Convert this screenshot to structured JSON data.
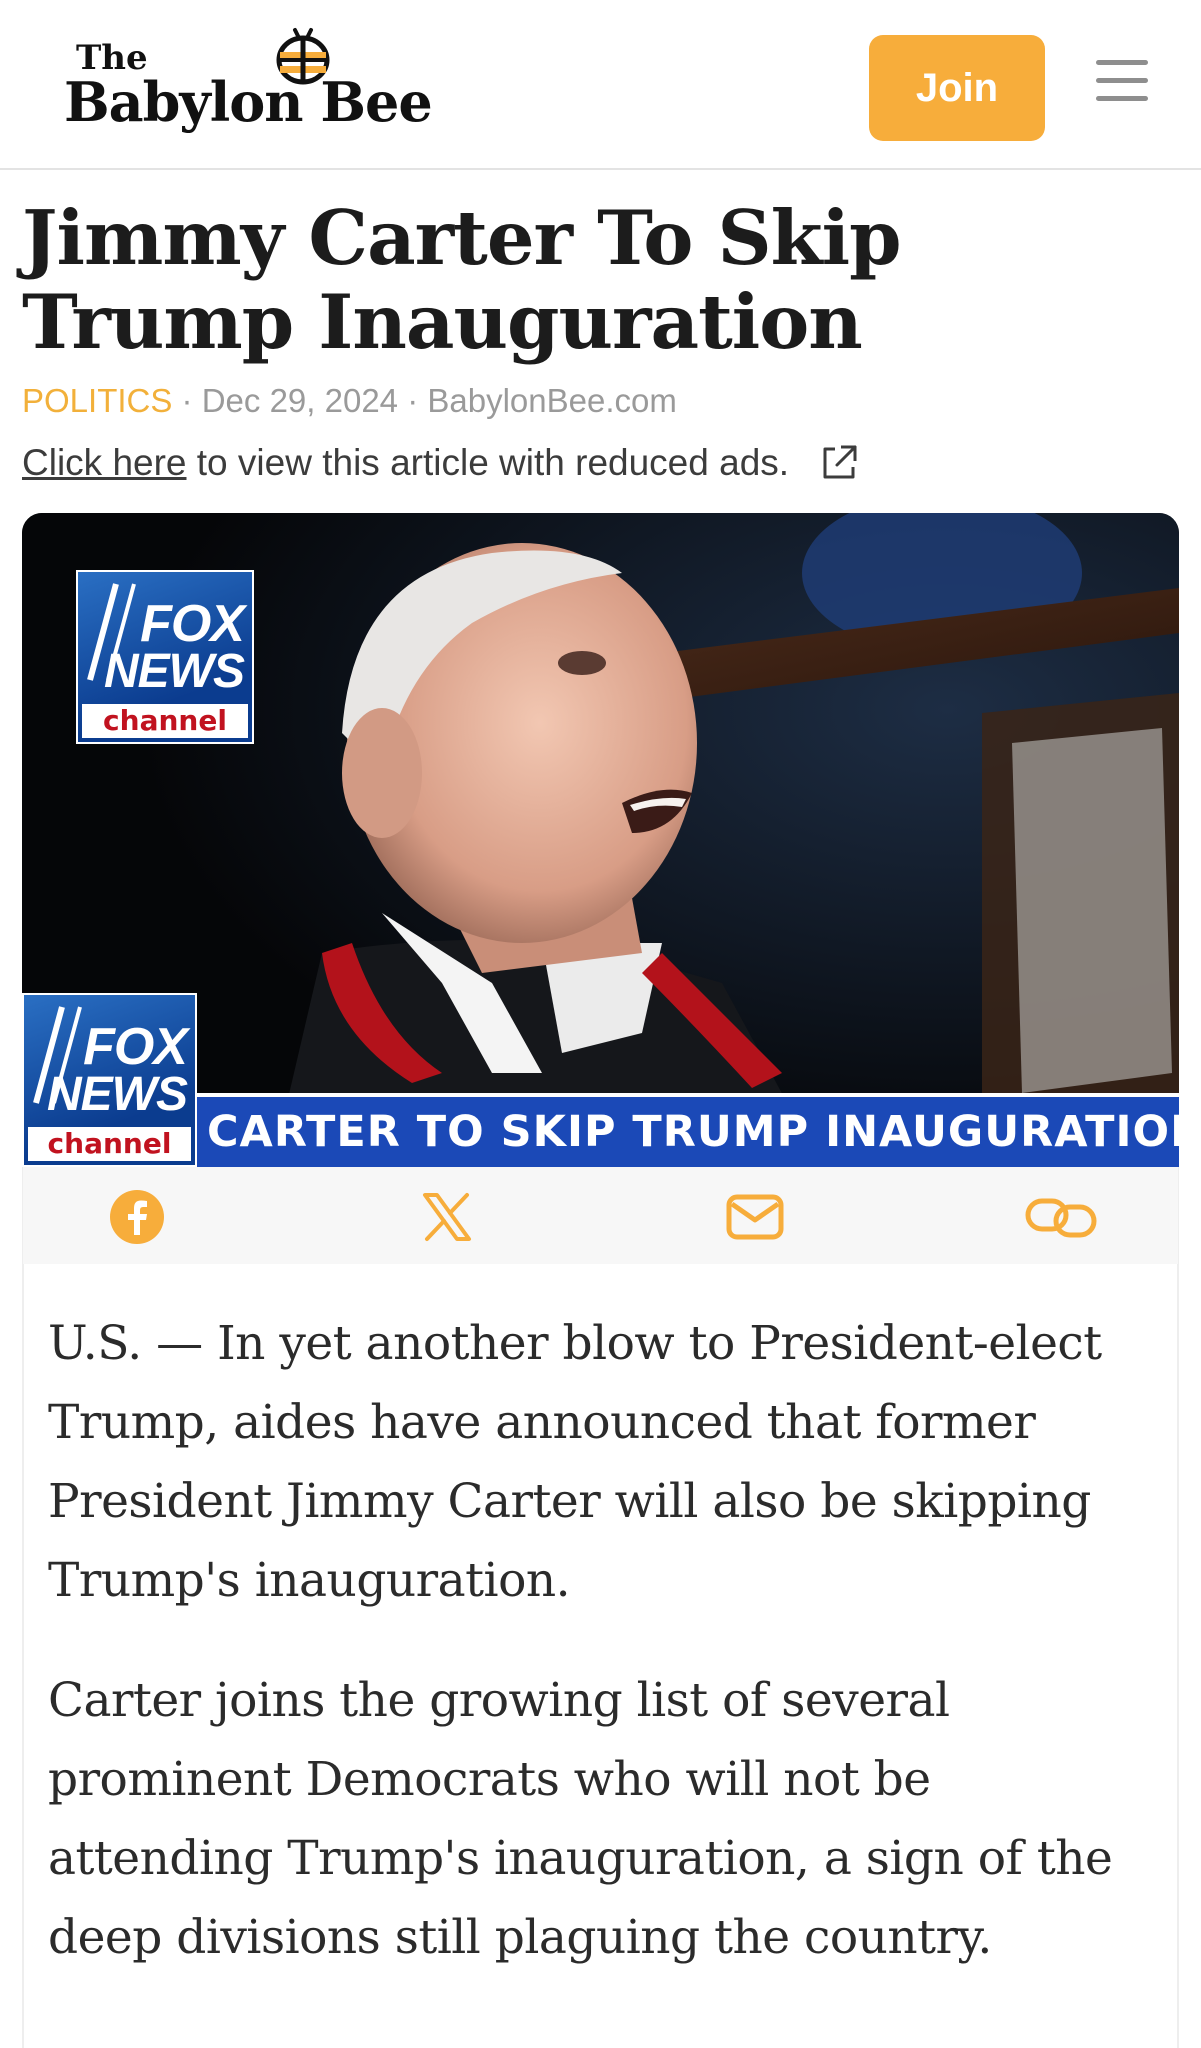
{
  "header": {
    "logo_the": "The",
    "logo_name": "Babylon Bee",
    "join_label": "Join",
    "brand_color": "#f7ad3b"
  },
  "article": {
    "headline": "Jimmy Carter To Skip Trump Inauguration",
    "category": "POLITICS",
    "separator": "·",
    "date": "Dec 29, 2024",
    "source": "BabylonBee.com",
    "reduced_ads_link": "Click here",
    "reduced_ads_text": "to view this article with reduced ads.",
    "image": {
      "logo_fox": "FOX",
      "logo_news": "NEWS",
      "logo_channel": "channel",
      "chyron": "CARTER TO SKIP TRUMP INAUGURATION"
    },
    "share_icons": [
      "facebook-icon",
      "x-icon",
      "email-icon",
      "link-icon"
    ],
    "paragraphs": [
      "U.S. — In yet another blow to President-elect Trump, aides have announced that former President Jimmy Carter will also be skipping Trump's inauguration.",
      "Carter joins the growing list of several prominent Democrats who will not be attending Trump's inauguration, a sign of the deep divisions still plaguing the country."
    ]
  }
}
